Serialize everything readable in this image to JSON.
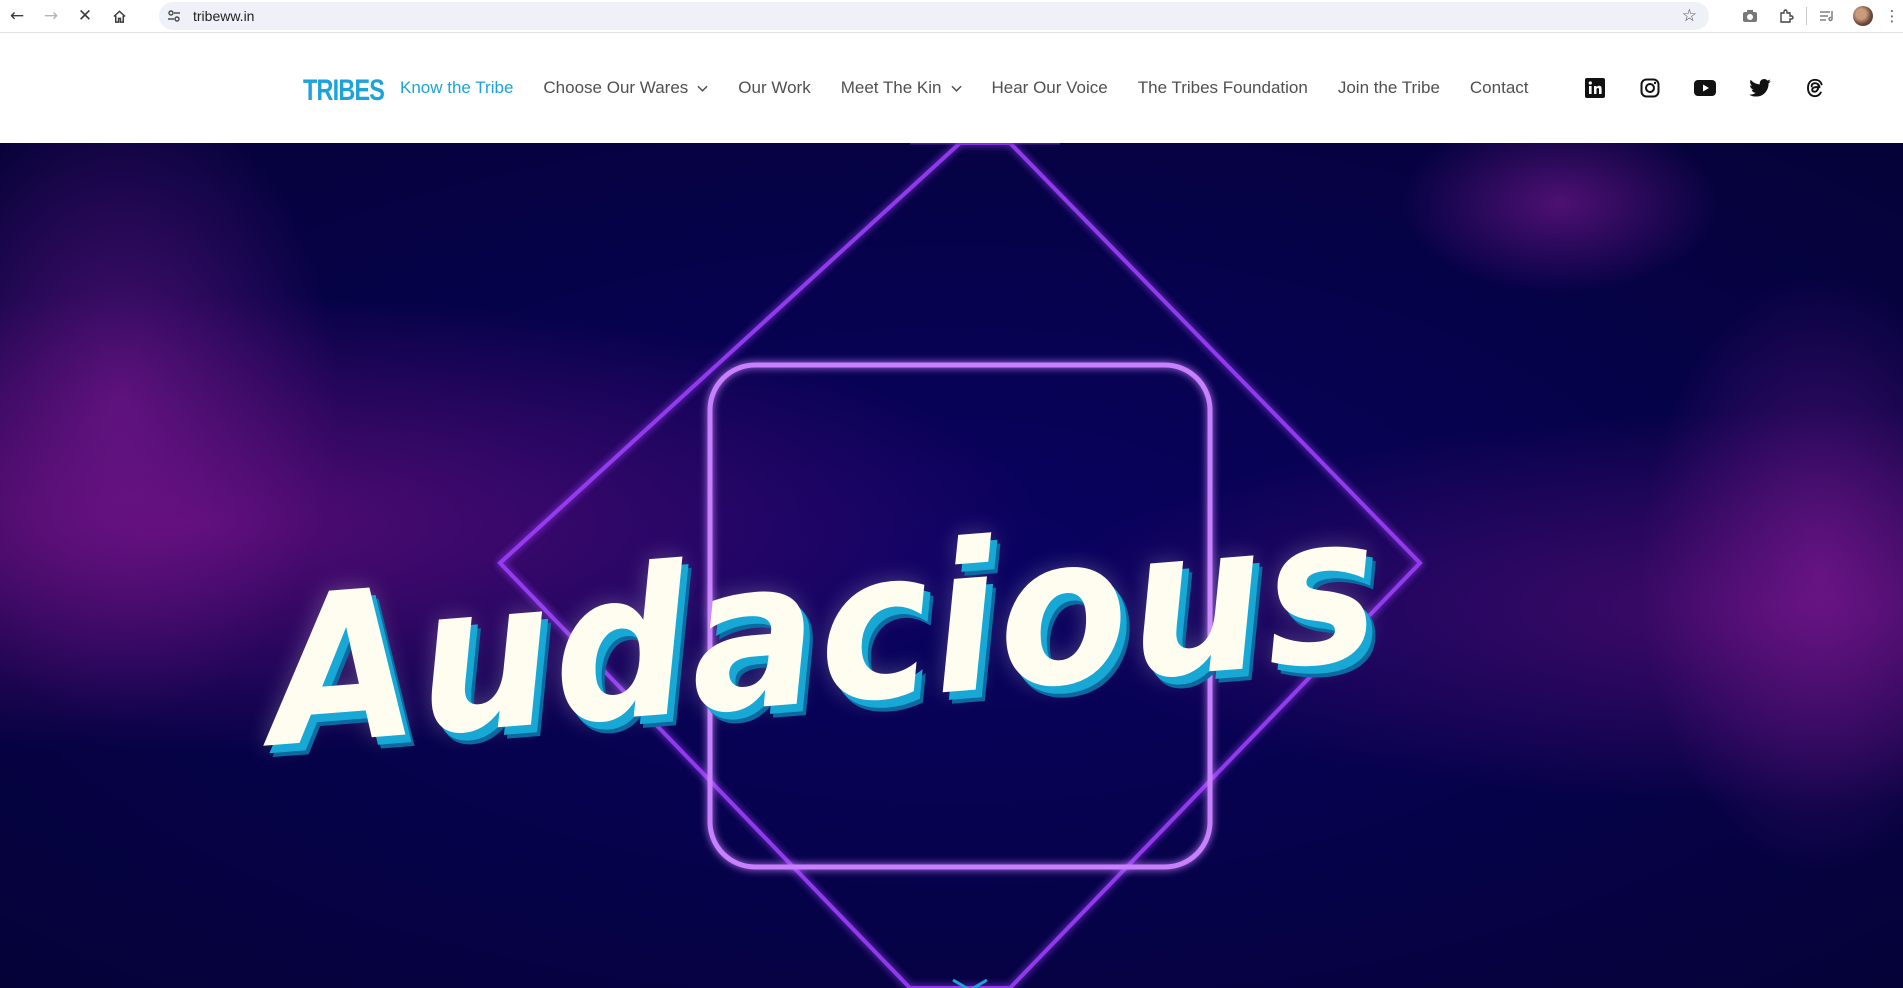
{
  "browser": {
    "url": "tribeww.in",
    "icons": {
      "back": "arrow-left-icon",
      "forward": "arrow-right-icon",
      "stop": "close-icon",
      "home": "home-icon",
      "site_info": "tune-icon",
      "bookmark": "star-icon",
      "screenshot": "camera-icon",
      "extensions": "puzzle-icon",
      "media": "media-queue-icon",
      "menu": "more-vertical-icon"
    }
  },
  "site": {
    "logo_text": "TRIBES",
    "nav": [
      {
        "label": "Know the Tribe",
        "active": true
      },
      {
        "label": "Choose Our Wares",
        "dropdown": true
      },
      {
        "label": "Our Work"
      },
      {
        "label": "Meet The Kin",
        "dropdown": true
      },
      {
        "label": "Hear Our Voice"
      },
      {
        "label": "The Tribes Foundation"
      },
      {
        "label": "Join the Tribe"
      },
      {
        "label": "Contact"
      }
    ],
    "social": [
      "linkedin-icon",
      "instagram-icon",
      "youtube-icon",
      "twitter-icon",
      "threads-icon"
    ]
  },
  "hero": {
    "word": "Audacious"
  },
  "colors": {
    "accent": "#1ea2da",
    "nav_text": "#505050",
    "hero_bg": "#06024a",
    "neon": "#b050ff"
  }
}
